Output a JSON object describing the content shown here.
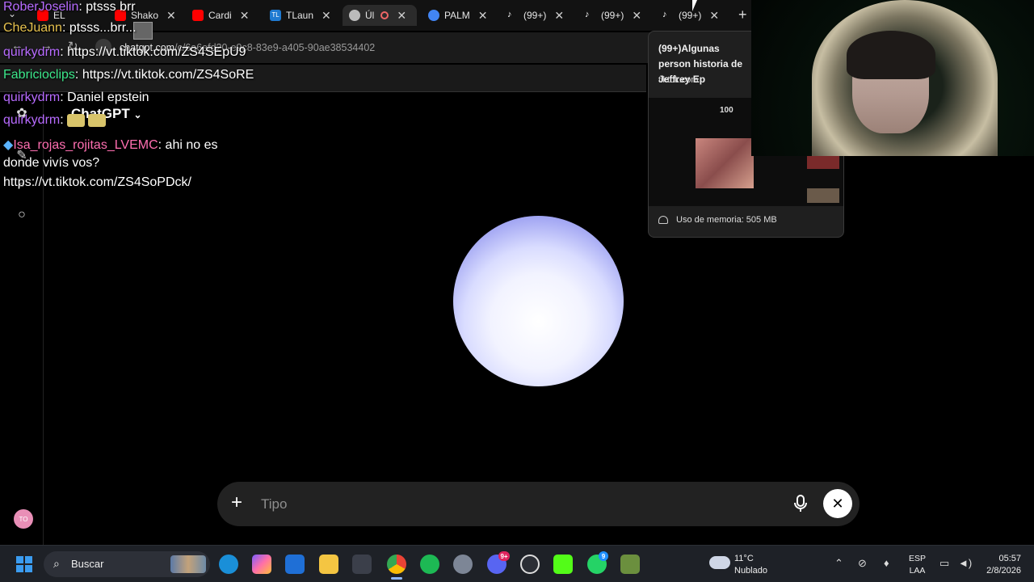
{
  "browser": {
    "tabs": [
      {
        "label": "EL",
        "favicon_color": "#ff0000"
      },
      {
        "label": "Shako",
        "favicon_color": "#ff0000"
      },
      {
        "label": "Cardi",
        "favicon_color": "#ff0000"
      },
      {
        "label": "TLaun",
        "favicon_color": "#1f7ad1"
      },
      {
        "label": "Úl",
        "favicon_color": "#bbbbbb"
      },
      {
        "label": "PALM",
        "favicon_color": "#4285f4"
      },
      {
        "label": "(99+)",
        "favicon_color": "#ffffff"
      },
      {
        "label": "(99+)",
        "favicon_color": "#ffffff"
      },
      {
        "label": "(99+)",
        "favicon_color": "#ffffff"
      }
    ],
    "new_tab_label": "+",
    "url_host": "chatgpt.com",
    "url_path": "/c/6a6efd20-e9c8-83e9-a405-90ae38534402"
  },
  "hover_card": {
    "title": "(99+)Algunas person historia de Jeffrey Ep",
    "host": "tiktok.com",
    "memory": "Uso de memoria: 505 MB",
    "thumb_logo": "100"
  },
  "chatgpt": {
    "model": "ChatGPT",
    "composer_placeholder": "Tipo",
    "avatar_initials": "TO",
    "accent": "#7a7fe8"
  },
  "stream_chat": [
    {
      "user": "RoberJoselin",
      "text": ": ptsss brr"
    },
    {
      "user": "CheJuann",
      "text": ": ptsss...brr..."
    },
    {
      "user": "quirkydrm",
      "text": ": https://vt.tiktok.com/ZS4SEpU9"
    },
    {
      "user": "Fabricioclips",
      "text": ": https://vt.tiktok.com/ZS4SoRE"
    },
    {
      "user": "quirkydrm",
      "text": ": Daniel epstein"
    },
    {
      "user": "quirkydrm",
      "text": ":"
    },
    {
      "user": "Isa_rojas_rojitas_LVEMC",
      "text": ": ahi no es"
    },
    {
      "user": "",
      "text": "donde vivís vos?"
    },
    {
      "user": "",
      "text": "https://vt.tiktok.com/ZS4SoPDck/"
    }
  ],
  "taskbar": {
    "search_label": "Buscar",
    "weather_temp": "11°C",
    "weather_desc": "Nublado",
    "lang_1": "ESP",
    "lang_2": "LAA",
    "time": "05:57",
    "date": "2/8/2026",
    "discord_badge": "9+",
    "whatsapp_badge": "9"
  }
}
